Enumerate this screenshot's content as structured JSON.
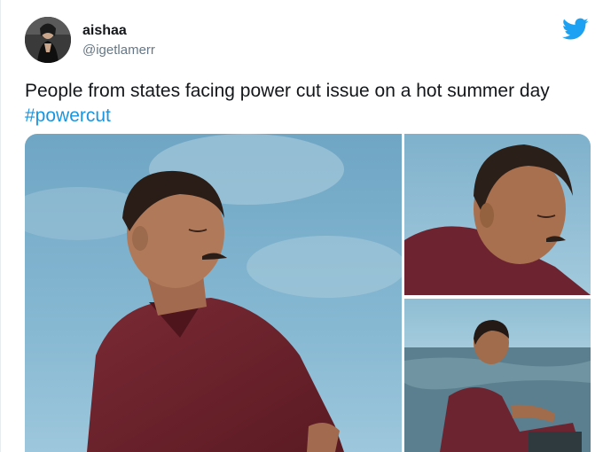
{
  "tweet": {
    "display_name": "aishaa",
    "handle": "@igetlamerr",
    "text": "People from states facing power cut issue on a hot summer day ",
    "hashtag": "#powercut"
  },
  "icons": {
    "brand": "twitter-bird-icon"
  },
  "colors": {
    "brand": "#1da1f2",
    "hashtag": "#1b95e0",
    "text": "#14171a",
    "secondary_text": "#657786"
  },
  "media": {
    "images": [
      {
        "name": "man-eyes-closed-sky-photo"
      },
      {
        "name": "man-looking-down-photo"
      },
      {
        "name": "man-sitting-by-water-photo"
      }
    ]
  }
}
